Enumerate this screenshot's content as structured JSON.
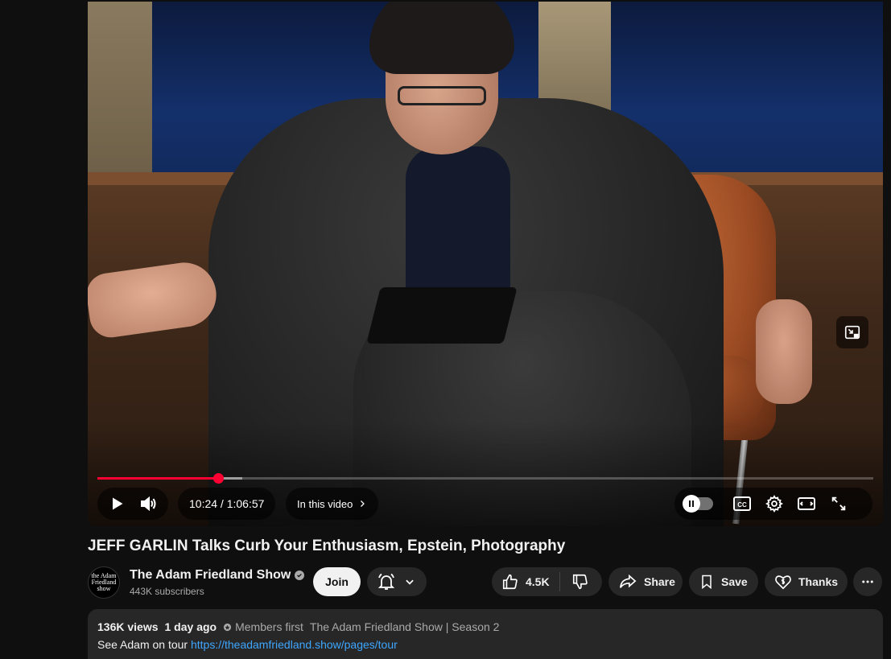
{
  "player": {
    "time_current": "10:24",
    "time_separator": " / ",
    "time_total": "1:06:57",
    "progress_fraction": 0.156,
    "buffer_fraction": 0.187,
    "chapters_label": "In this video",
    "cc_label": "CC",
    "icons": [
      "play-icon",
      "volume-icon",
      "chevron-right-icon",
      "pause-icon",
      "captions-icon",
      "gear-icon",
      "theater-icon",
      "fullscreen-icon",
      "miniplayer-icon"
    ]
  },
  "video": {
    "title": "JEFF GARLIN Talks Curb Your Enthusiasm, Epstein, Photography"
  },
  "channel": {
    "avatar_text": "the Adam Friedland show",
    "name": "The Adam Friedland Show",
    "subscribers": "443K subscribers",
    "join_label": "Join"
  },
  "actions": {
    "like_count": "4.5K",
    "share_label": "Share",
    "save_label": "Save",
    "thanks_label": "Thanks"
  },
  "description": {
    "views": "136K views",
    "date": "1 day ago",
    "members_first": "Members first",
    "playlist": "The Adam Friedland Show | Season 2",
    "line_prefix": "See Adam on tour ",
    "link": "https://theadamfriedland.show/pages/tour"
  },
  "colors": {
    "background": "#0f0f0f",
    "accent_red": "#ff0033",
    "link_blue": "#3ea6ff",
    "pill_bg": "#272727"
  }
}
